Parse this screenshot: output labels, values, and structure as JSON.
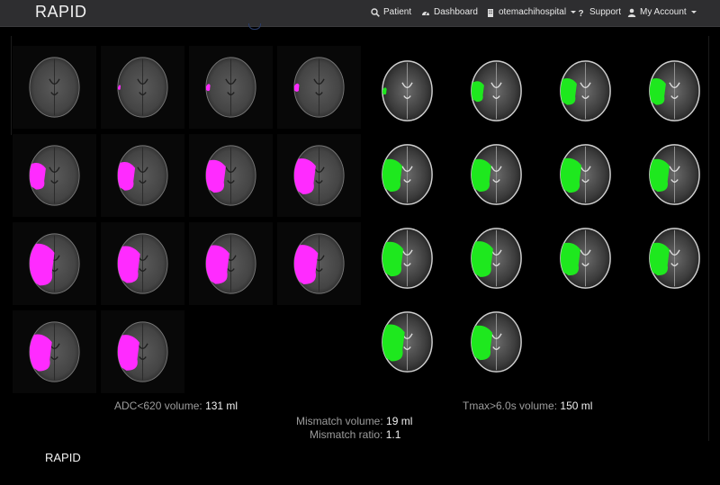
{
  "nav": {
    "brand": "RAPID",
    "items": [
      {
        "id": "patient",
        "label": "Patient",
        "icon": "search-icon"
      },
      {
        "id": "dashboard",
        "label": "Dashboard",
        "icon": "dashboard-icon"
      },
      {
        "id": "hospital",
        "label": "otemachihospital",
        "icon": "building-icon",
        "dropdown": true
      },
      {
        "id": "support",
        "label": "Support",
        "icon": "question-icon"
      },
      {
        "id": "account",
        "label": "My Account",
        "icon": "user-icon",
        "dropdown": true
      }
    ]
  },
  "adc": {
    "label": "ADC<620 volume:",
    "value": "131 ml",
    "lesion_color": "#ff2bff",
    "lesion_extent": [
      0,
      0.08,
      0.12,
      0.14,
      0.45,
      0.48,
      0.55,
      0.6,
      0.7,
      0.62,
      0.65,
      0.66,
      0.62,
      0.6
    ]
  },
  "tmax": {
    "label": "Tmax>6.0s volume:",
    "value": "150 ml",
    "lesion_color": "#1ee81e",
    "lesion_extent": [
      0.12,
      0.35,
      0.45,
      0.45,
      0.55,
      0.55,
      0.58,
      0.55,
      0.58,
      0.6,
      0.55,
      0.55,
      0.62,
      0.58
    ]
  },
  "mismatch": {
    "volume_label": "Mismatch volume:",
    "volume_value": "19 ml",
    "ratio_label": "Mismatch ratio:",
    "ratio_value": "1.1"
  },
  "footer": {
    "brand": "RAPID"
  }
}
